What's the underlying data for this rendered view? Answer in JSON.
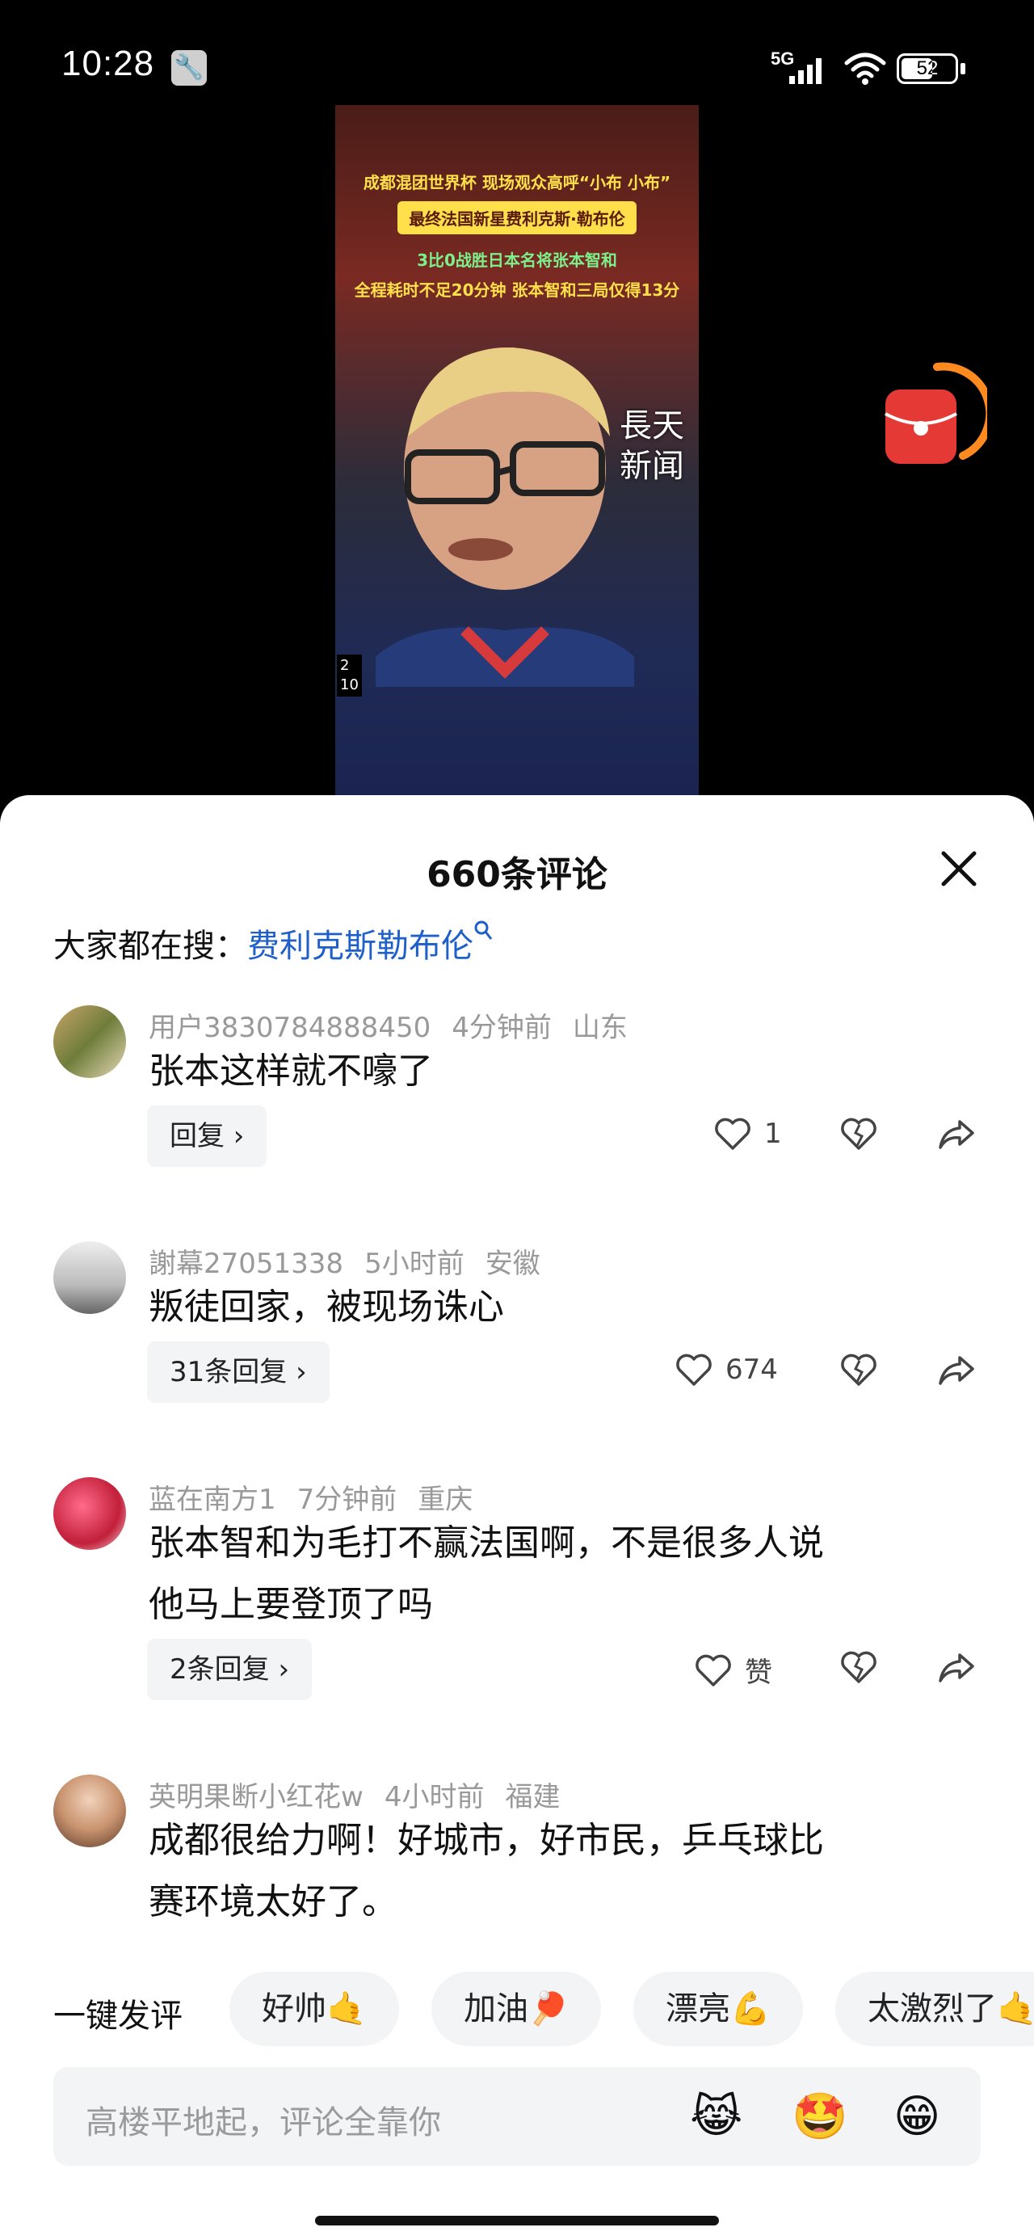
{
  "status": {
    "time": "10:28",
    "network": "5G",
    "battery": "52"
  },
  "video": {
    "line1": "成都混团世界杯 现场观众高呼“小布 小布”",
    "line2": "最终法国新星费利克斯·勒布伦",
    "line3": "3比0战胜日本名将张本智和",
    "line4": "全程耗时不足20分钟 张本智和三局仅得13分",
    "brand_line1": "長天",
    "brand_line2": "新闻",
    "score_top": "2",
    "score_bottom": "10"
  },
  "sheet": {
    "title": "660条评论",
    "search_prefix": "大家都在搜：",
    "search_keyword": "费利克斯勒布伦"
  },
  "comments": [
    {
      "user": "用户3830784888450",
      "time": "4分钟前",
      "region": "山东",
      "text": "张本这样就不嚎了",
      "reply_label": "回复",
      "likes": "1"
    },
    {
      "user": "謝幕27051338",
      "time": "5小时前",
      "region": "安徽",
      "text": "叛徒回家，被现场诛心",
      "reply_label": "31条回复",
      "likes": "674"
    },
    {
      "user": "蓝在南方1",
      "time": "7分钟前",
      "region": "重庆",
      "text_line1": "张本智和为毛打不赢法国啊，不是很多人说",
      "text_line2": "他马上要登顶了吗",
      "reply_label": "2条回复",
      "likes": "赞"
    },
    {
      "user": "英明果断小红花w",
      "time": "4小时前",
      "region": "福建",
      "text_line1": "成都很给力啊！好城市，好市民，乒乓球比",
      "text_line2": "赛环境太好了。"
    }
  ],
  "quick": {
    "label": "一键发评",
    "chips": [
      "好帅🤙",
      "加油🏓",
      "漂亮💪",
      "太激烈了🤙"
    ]
  },
  "input": {
    "placeholder": "高楼平地起，评论全靠你",
    "emojis": [
      "😹",
      "🤩",
      "😁"
    ]
  },
  "colors": {
    "accent_link": "#1e5fc9",
    "redpack": "#e53935",
    "ring": "#ff8a1f"
  }
}
